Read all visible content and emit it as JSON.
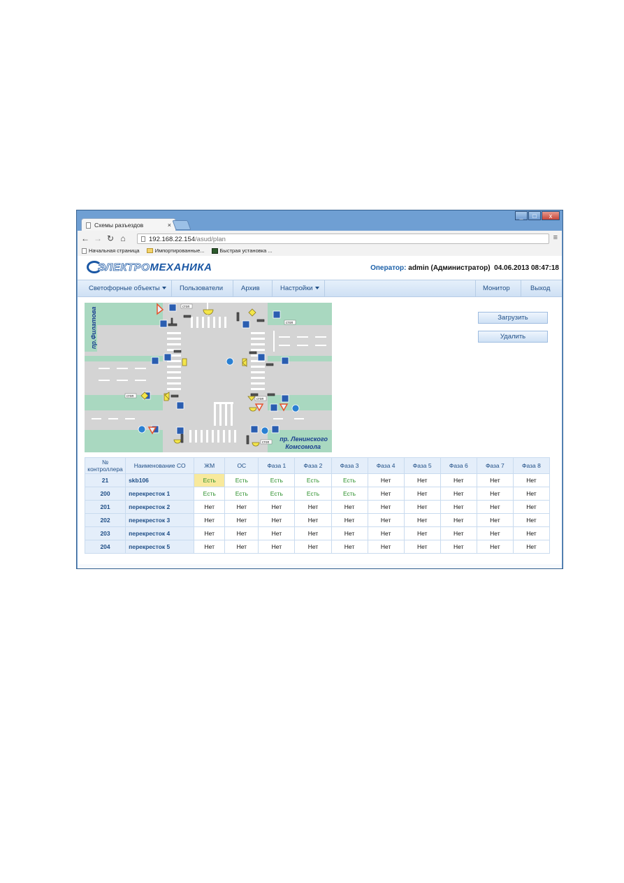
{
  "browser": {
    "tab_title": "Схемы разъездов",
    "tab_close": "×",
    "url_host": "192.168.22.154",
    "url_path": "/asud/plan",
    "bookmarks": [
      "Начальная страница",
      "Импортированные...",
      "Быстрая установка ..."
    ],
    "window_controls": [
      "_",
      "□",
      "x"
    ]
  },
  "header": {
    "logo_part1": "ЭЛЕКТРО",
    "logo_part2": "МЕХАНИКА",
    "operator_label": "Оператор:",
    "operator_name": "admin (Администратор)",
    "datetime": "04.06.2013 08:47:18"
  },
  "nav": {
    "items": [
      "Светофорные объекты",
      "Пользователи",
      "Архив",
      "Настройки"
    ],
    "right_items": [
      "Монитор",
      "Выход"
    ]
  },
  "map": {
    "street_top_left": "пр.Филатова",
    "street_bottom_right_1": "пр. Ленинского",
    "street_bottom_right_2": "Комсомола",
    "stop_label": "стоп"
  },
  "actions": {
    "load": "Загрузить",
    "delete": "Удалить"
  },
  "table": {
    "headers": [
      "№ контроллера",
      "Наименование СО",
      "ЖМ",
      "ОС",
      "Фаза 1",
      "Фаза 2",
      "Фаза 3",
      "Фаза 4",
      "Фаза 5",
      "Фаза 6",
      "Фаза 7",
      "Фаза 8"
    ],
    "rows": [
      {
        "num": "21",
        "name": "skb106",
        "cells": [
          "Есть",
          "Есть",
          "Есть",
          "Есть",
          "Есть",
          "Нет",
          "Нет",
          "Нет",
          "Нет",
          "Нет"
        ]
      },
      {
        "num": "200",
        "name": "перекресток 1",
        "cells": [
          "Есть",
          "Есть",
          "Есть",
          "Есть",
          "Есть",
          "Нет",
          "Нет",
          "Нет",
          "Нет",
          "Нет"
        ]
      },
      {
        "num": "201",
        "name": "перекресток 2",
        "cells": [
          "Нет",
          "Нет",
          "Нет",
          "Нет",
          "Нет",
          "Нет",
          "Нет",
          "Нет",
          "Нет",
          "Нет"
        ]
      },
      {
        "num": "202",
        "name": "перекресток 3",
        "cells": [
          "Нет",
          "Нет",
          "Нет",
          "Нет",
          "Нет",
          "Нет",
          "Нет",
          "Нет",
          "Нет",
          "Нет"
        ]
      },
      {
        "num": "203",
        "name": "перекресток 4",
        "cells": [
          "Нет",
          "Нет",
          "Нет",
          "Нет",
          "Нет",
          "Нет",
          "Нет",
          "Нет",
          "Нет",
          "Нет"
        ]
      },
      {
        "num": "204",
        "name": "перекресток 5",
        "cells": [
          "Нет",
          "Нет",
          "Нет",
          "Нет",
          "Нет",
          "Нет",
          "Нет",
          "Нет",
          "Нет",
          "Нет"
        ]
      }
    ]
  },
  "colors": {
    "accent": "#1a57a4",
    "yes_text": "#2a8f2a",
    "highlight": "#f8e99c"
  }
}
